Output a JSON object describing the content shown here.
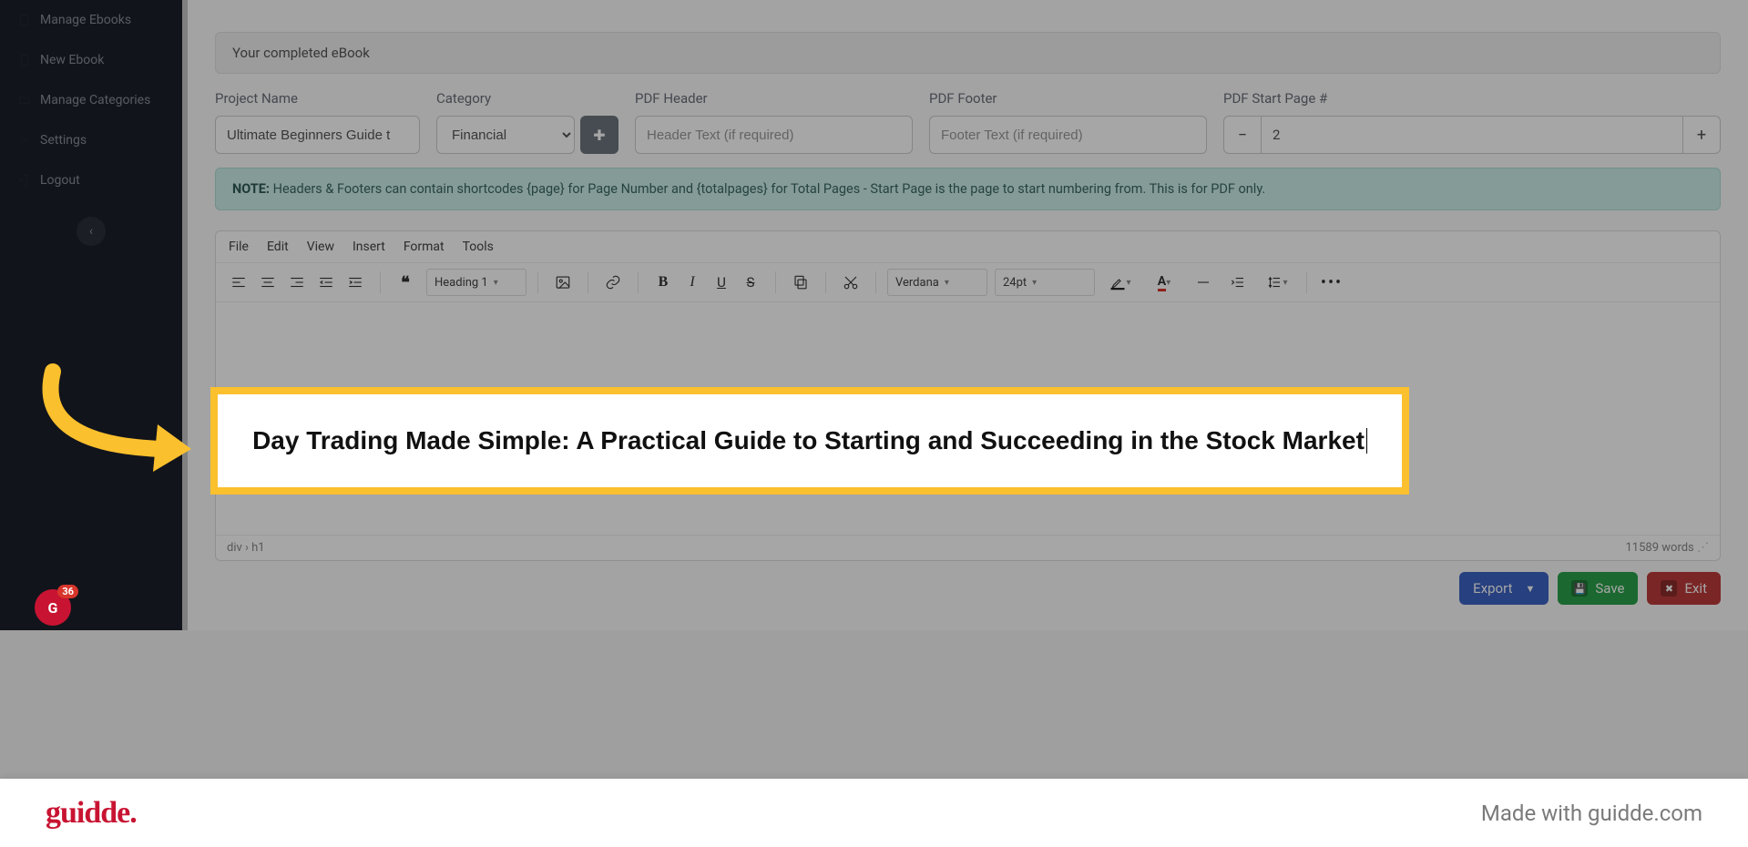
{
  "sidebar": {
    "items": [
      {
        "label": "Manage Ebooks",
        "icon": "book-icon"
      },
      {
        "label": "New Ebook",
        "icon": "file-icon"
      },
      {
        "label": "Manage Categories",
        "icon": "folder-icon"
      },
      {
        "label": "Settings",
        "icon": "gear-icon"
      },
      {
        "label": "Logout",
        "icon": "logout-icon"
      }
    ]
  },
  "panel": {
    "section_title": "Your completed eBook",
    "fields": {
      "project_name": {
        "label": "Project Name",
        "value": "Ultimate Beginners Guide t"
      },
      "category": {
        "label": "Category",
        "selected": "Financial"
      },
      "pdf_header": {
        "label": "PDF Header",
        "placeholder": "Header Text (if required)",
        "value": ""
      },
      "pdf_footer": {
        "label": "PDF Footer",
        "placeholder": "Footer Text (if required)",
        "value": ""
      },
      "start_page": {
        "label": "PDF Start Page #",
        "value": "2"
      }
    },
    "note_label": "NOTE:",
    "note": "Headers & Footers can contain shortcodes {page} for Page Number and {totalpages} for Total Pages - Start Page is the page to start numbering from. This is for PDF only."
  },
  "editor": {
    "menus": [
      "File",
      "Edit",
      "View",
      "Insert",
      "Format",
      "Tools"
    ],
    "block_format": "Heading 1",
    "font_family": "Verdana",
    "font_size": "24pt",
    "heading": "Day Trading Made Simple: A Practical Guide to Starting and Succeeding in the Stock Market",
    "status_path": "div › h1",
    "word_count": "11589 words"
  },
  "actions": {
    "export": "Export",
    "save": "Save",
    "exit": "Exit"
  },
  "guidde": {
    "logo": "guidde.",
    "made": "Made with guidde.com"
  },
  "avatar": {
    "badge": "36"
  }
}
